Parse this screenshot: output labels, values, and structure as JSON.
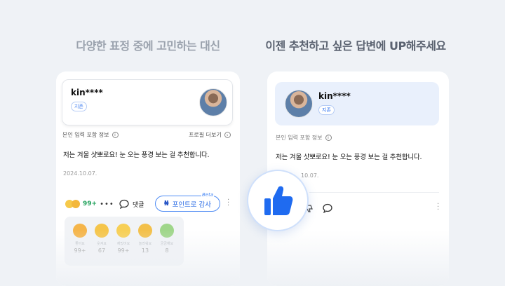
{
  "left_heading": "다양한 표정 중에 고민하는 대신",
  "right_heading": "이젠 추천하고 싶은 답변에 UP해주세요",
  "profile": {
    "name": "kin****",
    "badge": "지존"
  },
  "info_label": "본인 입력 포함 정보",
  "profile_more": "프로필 더보기",
  "answer_text": "저는 겨울 샷뽀로요! 눈 오는 풍경 보는 걸 추천합니다.",
  "date": "2024.10.07.",
  "date_partial": "10.07.",
  "reaction_count": "99+",
  "comment_label": "댓글",
  "points_button": "포인트로 감사",
  "beta_label": "Beta",
  "reactions": [
    {
      "label": "좋아요",
      "count": "99+"
    },
    {
      "label": "웃겨요",
      "count": "67"
    },
    {
      "label": "재밌어요",
      "count": "99+"
    },
    {
      "label": "놀라워요",
      "count": "13"
    },
    {
      "label": "궁금해요",
      "count": "8"
    }
  ],
  "colors": {
    "accent": "#2f6fe6",
    "thumb": "#1f6bf0",
    "green": "#1fa05a"
  }
}
